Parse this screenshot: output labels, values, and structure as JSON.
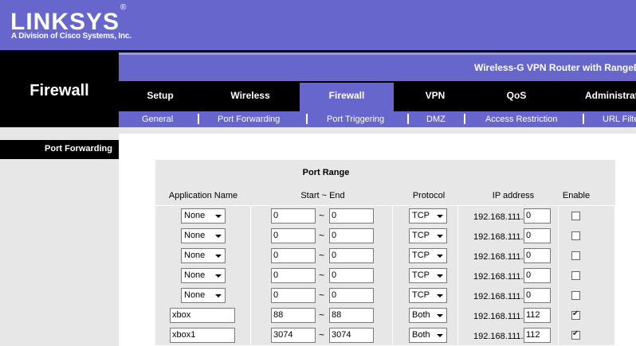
{
  "brand": {
    "name": "LINKSYS",
    "trademark": "®",
    "tagline": "A Division of Cisco Systems, Inc."
  },
  "product": {
    "name": "Wireless-G VPN Router with RangeBo"
  },
  "section": {
    "title": "Firewall"
  },
  "tabs": [
    {
      "label": "Setup"
    },
    {
      "label": "Wireless"
    },
    {
      "label": "Firewall",
      "active": true
    },
    {
      "label": "VPN"
    },
    {
      "label": "QoS"
    },
    {
      "label": "Administrat"
    }
  ],
  "subtabs": [
    {
      "label": "General"
    },
    {
      "label": "Port Forwarding"
    },
    {
      "label": "Port Triggering"
    },
    {
      "label": "DMZ"
    },
    {
      "label": "Access Restriction"
    },
    {
      "label": "URL Filte"
    }
  ],
  "sidebar": {
    "label": "Port Forwarding"
  },
  "table": {
    "port_range_header": "Port Range",
    "columns": {
      "app": "Application Name",
      "range": "Start ~ End",
      "protocol": "Protocol",
      "ip": "IP address",
      "enable": "Enable"
    },
    "tilde": "~",
    "rows": [
      {
        "app": "None",
        "app_is_select": true,
        "start": "0",
        "end": "0",
        "protocol": "TCP",
        "ip_prefix": "192.168.111.",
        "ip_last": "0",
        "enabled": false
      },
      {
        "app": "None",
        "app_is_select": true,
        "start": "0",
        "end": "0",
        "protocol": "TCP",
        "ip_prefix": "192.168.111.",
        "ip_last": "0",
        "enabled": false
      },
      {
        "app": "None",
        "app_is_select": true,
        "start": "0",
        "end": "0",
        "protocol": "TCP",
        "ip_prefix": "192.168.111.",
        "ip_last": "0",
        "enabled": false
      },
      {
        "app": "None",
        "app_is_select": true,
        "start": "0",
        "end": "0",
        "protocol": "TCP",
        "ip_prefix": "192.168.111.",
        "ip_last": "0",
        "enabled": false
      },
      {
        "app": "None",
        "app_is_select": true,
        "start": "0",
        "end": "0",
        "protocol": "TCP",
        "ip_prefix": "192.168.111.",
        "ip_last": "0",
        "enabled": false
      },
      {
        "app": "xbox",
        "app_is_select": false,
        "start": "88",
        "end": "88",
        "protocol": "Both",
        "ip_prefix": "192.168.111.",
        "ip_last": "112",
        "enabled": true
      },
      {
        "app": "xbox1",
        "app_is_select": false,
        "start": "3074",
        "end": "3074",
        "protocol": "Both",
        "ip_prefix": "192.168.111.",
        "ip_last": "112",
        "enabled": true
      }
    ]
  }
}
